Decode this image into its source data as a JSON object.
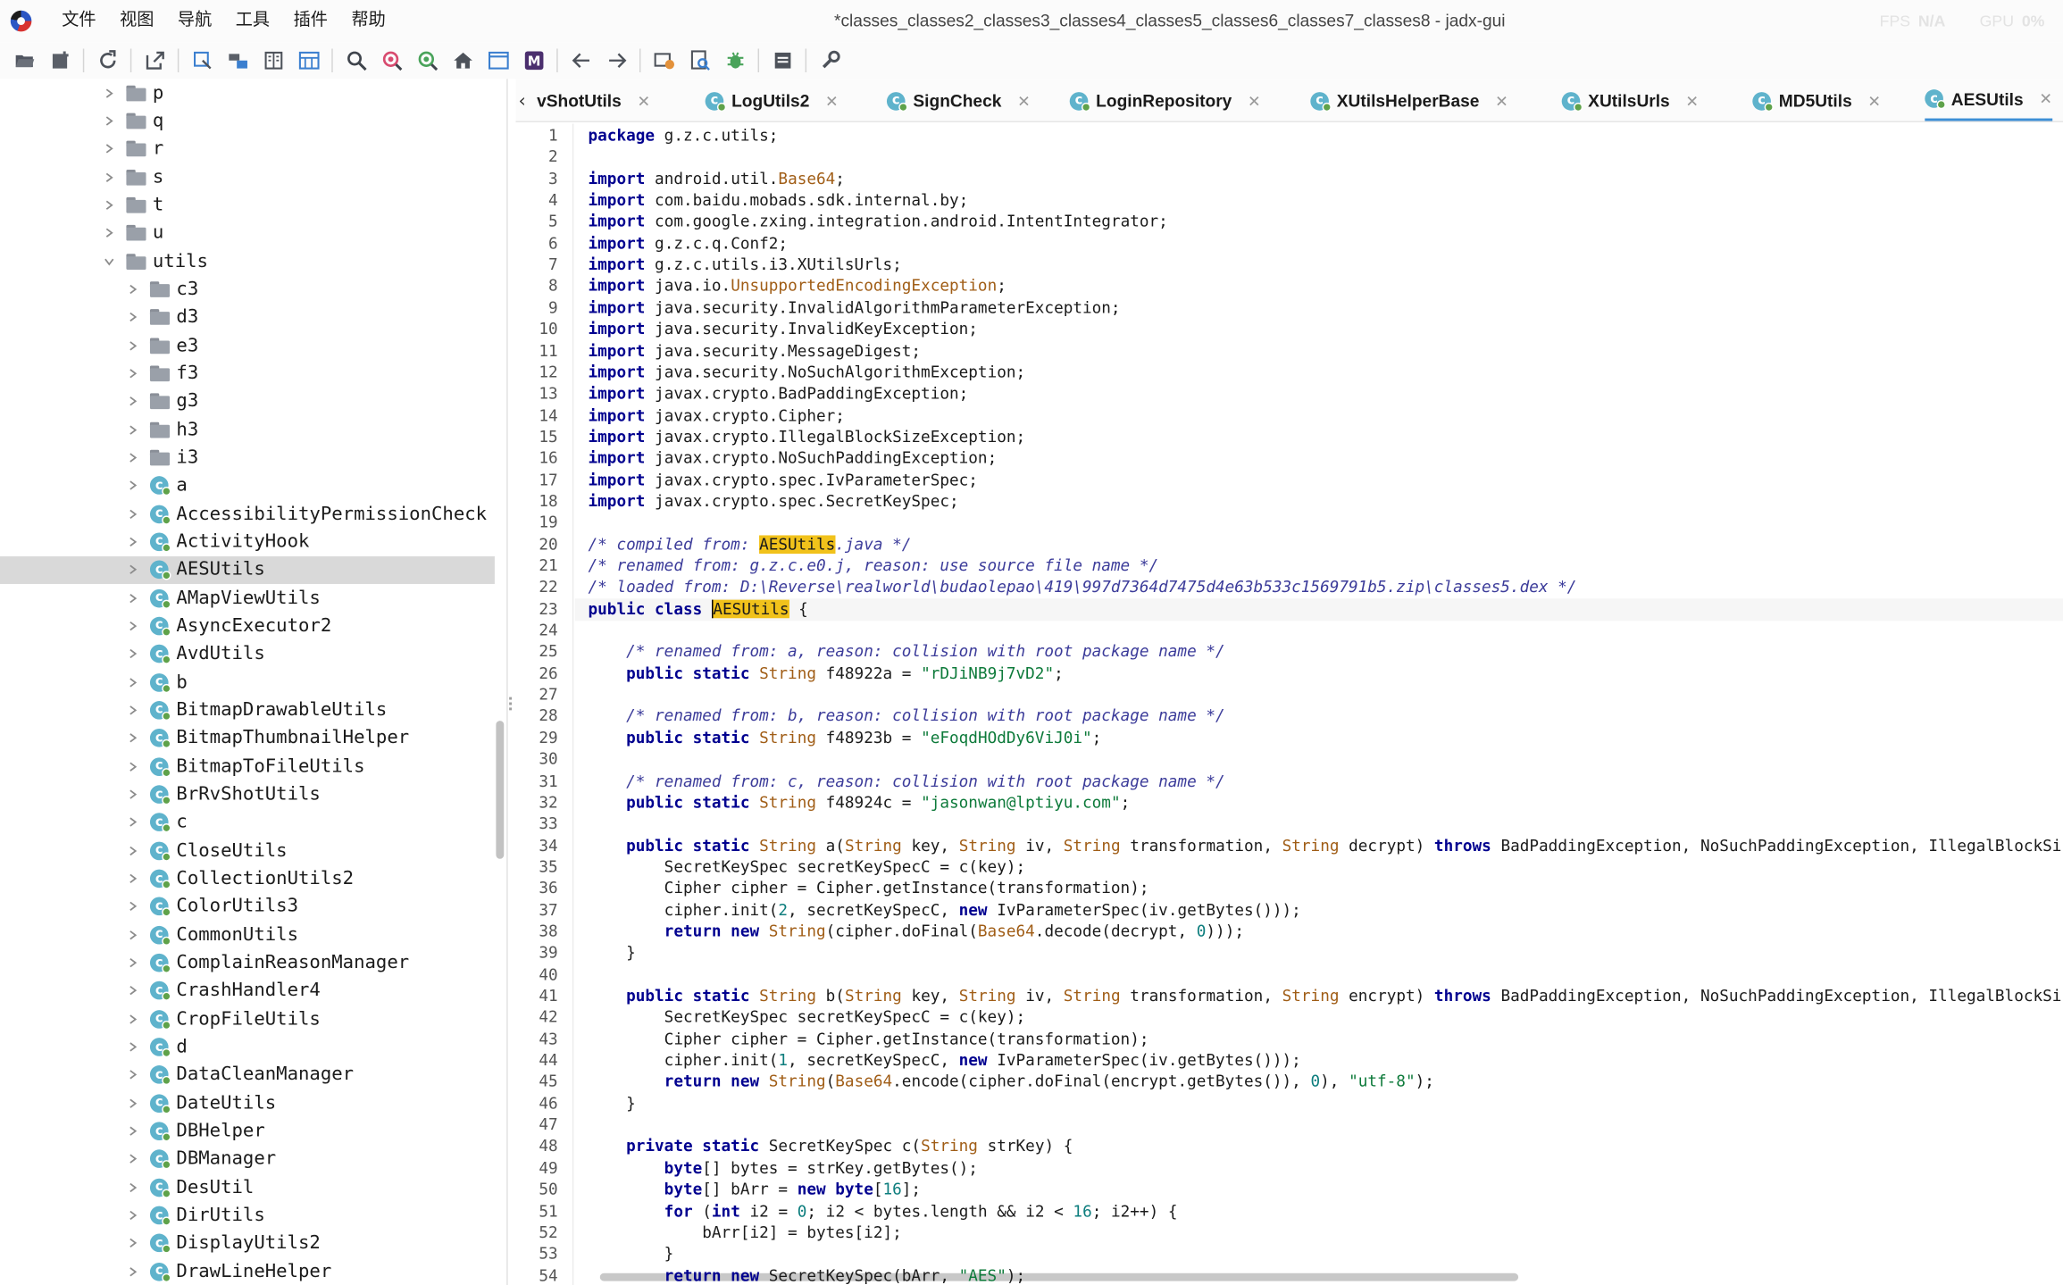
{
  "menubar": {
    "items": [
      "文件",
      "视图",
      "导航",
      "工具",
      "插件",
      "帮助"
    ],
    "window_title": "*classes_classes2_classes3_classes4_classes5_classes6_classes7_classes8 - jadx-gui",
    "fps_label": "FPS",
    "fps_value": "N/A",
    "gpu_label": "GPU",
    "gpu_value": "0%"
  },
  "toolbar": {
    "buttons": [
      "open-icon",
      "add-files-icon",
      "reload-icon",
      "export-icon",
      "sync-tree-icon",
      "flatten-packages-icon",
      "split-view-icon",
      "rename-icon",
      "search-icon",
      "find-usage-icon",
      "code-search-icon",
      "home-icon",
      "log-viewer-icon",
      "smali-icon",
      "back-icon",
      "forward-icon",
      "quark-icon",
      "deobfuscate-icon",
      "debug-icon",
      "logcat-icon",
      "preferences-icon"
    ]
  },
  "tree": {
    "folders": [
      "p",
      "q",
      "r",
      "s",
      "t",
      "u",
      "utils",
      "c3",
      "d3",
      "e3",
      "f3",
      "g3",
      "h3",
      "i3"
    ],
    "classes": [
      "a",
      "AccessibilityPermissionCheck",
      "ActivityHook",
      "AESUtils",
      "AMapViewUtils",
      "AsyncExecutor2",
      "AvdUtils",
      "b",
      "BitmapDrawableUtils",
      "BitmapThumbnailHelper",
      "BitmapToFileUtils",
      "BrRvShotUtils",
      "c",
      "CloseUtils",
      "CollectionUtils2",
      "ColorUtils3",
      "CommonUtils",
      "ComplainReasonManager",
      "CrashHandler4",
      "CropFileUtils",
      "d",
      "DataCleanManager",
      "DateUtils",
      "DBHelper",
      "DBManager",
      "DesUtil",
      "DirUtils",
      "DisplayUtils2",
      "DrawLineHelper"
    ],
    "selected": "AESUtils"
  },
  "tabs": [
    {
      "label": "vShotUtils"
    },
    {
      "label": "LogUtils2"
    },
    {
      "label": "SignCheck"
    },
    {
      "label": "LoginRepository"
    },
    {
      "label": "XUtilsHelperBase"
    },
    {
      "label": "XUtilsUrls"
    },
    {
      "label": "MD5Utils"
    },
    {
      "label": "AESUtils"
    }
  ],
  "editor": {
    "line_numbers": [
      "1",
      "2",
      "3",
      "4",
      "5",
      "6",
      "7",
      "8",
      "9",
      "10",
      "11",
      "12",
      "13",
      "14",
      "15",
      "16",
      "17",
      "18",
      "19",
      "20",
      "21",
      "22",
      "23",
      "24",
      "25",
      "26",
      "27",
      "28",
      "29",
      "30",
      "31",
      "32",
      "33",
      "34",
      "35",
      "36",
      "37",
      "38",
      "39",
      "40",
      "41",
      "42",
      "43",
      "44",
      "45",
      "46",
      "47",
      "48",
      "49",
      "50",
      "51",
      "52",
      "53",
      "54"
    ],
    "current_line": 23,
    "code": [
      [
        [
          "kw",
          "package"
        ],
        [
          "ty",
          " g.z.c.utils;"
        ]
      ],
      [],
      [
        [
          "kw",
          "import"
        ],
        [
          "ty",
          " android.util."
        ],
        [
          "ex",
          "Base64"
        ],
        [
          "ty",
          ";"
        ]
      ],
      [
        [
          "kw",
          "import"
        ],
        [
          "ty",
          " com.baidu.mobads.sdk.internal.by;"
        ]
      ],
      [
        [
          "kw",
          "import"
        ],
        [
          "ty",
          " com.google.zxing.integration.android.IntentIntegrator;"
        ]
      ],
      [
        [
          "kw",
          "import"
        ],
        [
          "ty",
          " g.z.c.q.Conf2;"
        ]
      ],
      [
        [
          "kw",
          "import"
        ],
        [
          "ty",
          " g.z.c.utils.i3.XUtilsUrls;"
        ]
      ],
      [
        [
          "kw",
          "import"
        ],
        [
          "ty",
          " java.io."
        ],
        [
          "ex",
          "UnsupportedEncodingException"
        ],
        [
          "ty",
          ";"
        ]
      ],
      [
        [
          "kw",
          "import"
        ],
        [
          "ty",
          " java.security.InvalidAlgorithmParameterException;"
        ]
      ],
      [
        [
          "kw",
          "import"
        ],
        [
          "ty",
          " java.security.InvalidKeyException;"
        ]
      ],
      [
        [
          "kw",
          "import"
        ],
        [
          "ty",
          " java.security.MessageDigest;"
        ]
      ],
      [
        [
          "kw",
          "import"
        ],
        [
          "ty",
          " java.security.NoSuchAlgorithmException;"
        ]
      ],
      [
        [
          "kw",
          "import"
        ],
        [
          "ty",
          " javax.crypto.BadPaddingException;"
        ]
      ],
      [
        [
          "kw",
          "import"
        ],
        [
          "ty",
          " javax.crypto.Cipher;"
        ]
      ],
      [
        [
          "kw",
          "import"
        ],
        [
          "ty",
          " javax.crypto.IllegalBlockSizeException;"
        ]
      ],
      [
        [
          "kw",
          "import"
        ],
        [
          "ty",
          " javax.crypto.NoSuchPaddingException;"
        ]
      ],
      [
        [
          "kw",
          "import"
        ],
        [
          "ty",
          " javax.crypto.spec.IvParameterSpec;"
        ]
      ],
      [
        [
          "kw",
          "import"
        ],
        [
          "ty",
          " javax.crypto.spec.SecretKeySpec;"
        ]
      ],
      [],
      [
        [
          "cm",
          "/* compiled from: "
        ],
        [
          "hl",
          "AESUtils"
        ],
        [
          "cm",
          ".java */"
        ]
      ],
      [
        [
          "cm",
          "/* renamed from: g.z.c.e0.j, reason: use source file name */"
        ]
      ],
      [
        [
          "cm",
          "/* loaded from: D:\\Reverse\\realworld\\budaolepao\\419\\997d7364d7475d4e63b533c1569791b5.zip\\classes5.dex */"
        ]
      ],
      [
        [
          "kw",
          "public class"
        ],
        [
          "ty",
          " "
        ],
        [
          "hl2",
          "AESUtils"
        ],
        [
          "ty",
          " {"
        ]
      ],
      [],
      [
        [
          "ty",
          "    "
        ],
        [
          "cm",
          "/* renamed from: a, reason: collision with root package name */"
        ]
      ],
      [
        [
          "ty",
          "    "
        ],
        [
          "kw",
          "public static"
        ],
        [
          "ex",
          " String"
        ],
        [
          "ty",
          " f48922a = "
        ],
        [
          "st",
          "\"rDJiNB9j7vD2\""
        ],
        [
          "ty",
          ";"
        ]
      ],
      [],
      [
        [
          "ty",
          "    "
        ],
        [
          "cm",
          "/* renamed from: b, reason: collision with root package name */"
        ]
      ],
      [
        [
          "ty",
          "    "
        ],
        [
          "kw",
          "public static"
        ],
        [
          "ex",
          " String"
        ],
        [
          "ty",
          " f48923b = "
        ],
        [
          "st",
          "\"eFoqdHOdDy6ViJ0i\""
        ],
        [
          "ty",
          ";"
        ]
      ],
      [],
      [
        [
          "ty",
          "    "
        ],
        [
          "cm",
          "/* renamed from: c, reason: collision with root package name */"
        ]
      ],
      [
        [
          "ty",
          "    "
        ],
        [
          "kw",
          "public static"
        ],
        [
          "ex",
          " String"
        ],
        [
          "ty",
          " f48924c = "
        ],
        [
          "st",
          "\"jasonwan@lptiyu.com\""
        ],
        [
          "ty",
          ";"
        ]
      ],
      [],
      [
        [
          "ty",
          "    "
        ],
        [
          "kw",
          "public static"
        ],
        [
          "ex",
          " String"
        ],
        [
          "ty",
          " a("
        ],
        [
          "ex",
          "String"
        ],
        [
          "ty",
          " key, "
        ],
        [
          "ex",
          "String"
        ],
        [
          "ty",
          " iv, "
        ],
        [
          "ex",
          "String"
        ],
        [
          "ty",
          " transformation, "
        ],
        [
          "ex",
          "String"
        ],
        [
          "ty",
          " decrypt) "
        ],
        [
          "kw",
          "throws"
        ],
        [
          "ty",
          " BadPaddingException, NoSuchPaddingException, IllegalBlockSizeException"
        ]
      ],
      [
        [
          "ty",
          "        SecretKeySpec secretKeySpecC = c(key);"
        ]
      ],
      [
        [
          "ty",
          "        Cipher cipher = Cipher.getInstance(transformation);"
        ]
      ],
      [
        [
          "ty",
          "        cipher.init("
        ],
        [
          "nu",
          "2"
        ],
        [
          "ty",
          ", secretKeySpecC, "
        ],
        [
          "kw",
          "new"
        ],
        [
          "ty",
          " IvParameterSpec(iv.getBytes()));"
        ]
      ],
      [
        [
          "ty",
          "        "
        ],
        [
          "kw",
          "return new"
        ],
        [
          "ex",
          " String"
        ],
        [
          "ty",
          "(cipher.doFinal("
        ],
        [
          "ex",
          "Base64"
        ],
        [
          "ty",
          ".decode(decrypt, "
        ],
        [
          "nu",
          "0"
        ],
        [
          "ty",
          ")));"
        ]
      ],
      [
        [
          "ty",
          "    }"
        ]
      ],
      [],
      [
        [
          "ty",
          "    "
        ],
        [
          "kw",
          "public static"
        ],
        [
          "ex",
          " String"
        ],
        [
          "ty",
          " b("
        ],
        [
          "ex",
          "String"
        ],
        [
          "ty",
          " key, "
        ],
        [
          "ex",
          "String"
        ],
        [
          "ty",
          " iv, "
        ],
        [
          "ex",
          "String"
        ],
        [
          "ty",
          " transformation, "
        ],
        [
          "ex",
          "String"
        ],
        [
          "ty",
          " encrypt) "
        ],
        [
          "kw",
          "throws"
        ],
        [
          "ty",
          " BadPaddingException, NoSuchPaddingException, IllegalBlockSizeException"
        ]
      ],
      [
        [
          "ty",
          "        SecretKeySpec secretKeySpecC = c(key);"
        ]
      ],
      [
        [
          "ty",
          "        Cipher cipher = Cipher.getInstance(transformation);"
        ]
      ],
      [
        [
          "ty",
          "        cipher.init("
        ],
        [
          "nu",
          "1"
        ],
        [
          "ty",
          ", secretKeySpecC, "
        ],
        [
          "kw",
          "new"
        ],
        [
          "ty",
          " IvParameterSpec(iv.getBytes()));"
        ]
      ],
      [
        [
          "ty",
          "        "
        ],
        [
          "kw",
          "return new"
        ],
        [
          "ex",
          " String"
        ],
        [
          "ty",
          "("
        ],
        [
          "ex",
          "Base64"
        ],
        [
          "ty",
          ".encode(cipher.doFinal(encrypt.getBytes()), "
        ],
        [
          "nu",
          "0"
        ],
        [
          "ty",
          "), "
        ],
        [
          "st",
          "\"utf-8\""
        ],
        [
          "ty",
          ");"
        ]
      ],
      [
        [
          "ty",
          "    }"
        ]
      ],
      [],
      [
        [
          "ty",
          "    "
        ],
        [
          "kw",
          "private static"
        ],
        [
          "ty",
          " SecretKeySpec c("
        ],
        [
          "ex",
          "String"
        ],
        [
          "ty",
          " strKey) {"
        ]
      ],
      [
        [
          "ty",
          "        "
        ],
        [
          "kw",
          "byte"
        ],
        [
          "ty",
          "[] bytes = strKey.getBytes();"
        ]
      ],
      [
        [
          "ty",
          "        "
        ],
        [
          "kw",
          "byte"
        ],
        [
          "ty",
          "[] bArr = "
        ],
        [
          "kw",
          "new byte"
        ],
        [
          "ty",
          "["
        ],
        [
          "nu",
          "16"
        ],
        [
          "ty",
          "];"
        ]
      ],
      [
        [
          "ty",
          "        "
        ],
        [
          "kw",
          "for"
        ],
        [
          "ty",
          " ("
        ],
        [
          "kw",
          "int"
        ],
        [
          "ty",
          " i2 = "
        ],
        [
          "nu",
          "0"
        ],
        [
          "ty",
          "; i2 < bytes.length && i2 < "
        ],
        [
          "nu",
          "16"
        ],
        [
          "ty",
          "; i2++) {"
        ]
      ],
      [
        [
          "ty",
          "            bArr[i2] = bytes[i2];"
        ]
      ],
      [
        [
          "ty",
          "        }"
        ]
      ],
      [
        [
          "ty",
          "        "
        ],
        [
          "kw",
          "return new"
        ],
        [
          "ty",
          " SecretKeySpec(bArr, "
        ],
        [
          "st",
          "\"AES\""
        ],
        [
          "ty",
          ");"
        ]
      ]
    ]
  }
}
